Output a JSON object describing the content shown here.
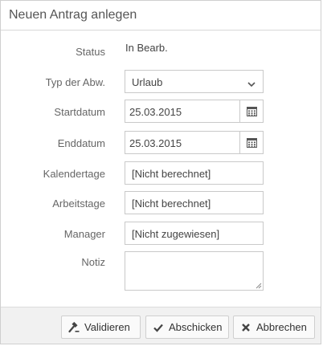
{
  "dialog": {
    "title": "Neuen Antrag anlegen"
  },
  "form": {
    "status": {
      "label": "Status",
      "value": "In Bearb."
    },
    "type": {
      "label": "Typ der Abw.",
      "value": "Urlaub"
    },
    "start": {
      "label": "Startdatum",
      "value": "25.03.2015"
    },
    "end": {
      "label": "Enddatum",
      "value": "25.03.2015"
    },
    "calendar_days": {
      "label": "Kalendertage",
      "value": "[Nicht berechnet]"
    },
    "work_days": {
      "label": "Arbeitstage",
      "value": "[Nicht berechnet]"
    },
    "manager": {
      "label": "Manager",
      "value": "[Nicht zugewiesen]"
    },
    "note": {
      "label": "Notiz",
      "value": ""
    }
  },
  "footer": {
    "validate_label": "Validieren",
    "submit_label": "Abschicken",
    "cancel_label": "Abbrechen"
  },
  "icons": {
    "dropdown": "chevron-down-icon",
    "calendar": "calendar-icon",
    "validate": "gavel-icon",
    "submit": "check-icon",
    "cancel": "close-icon"
  }
}
